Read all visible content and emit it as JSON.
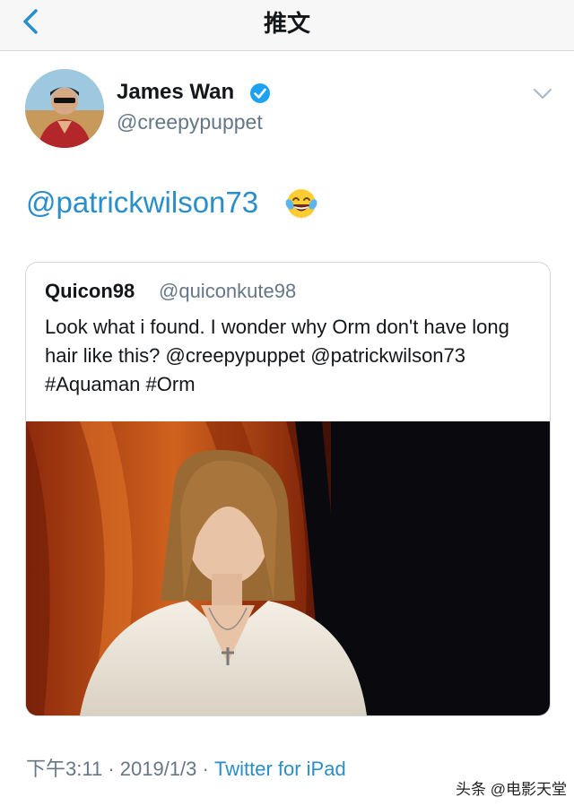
{
  "nav": {
    "title": "推文"
  },
  "tweet": {
    "author_name": "James Wan",
    "author_handle": "@creepypuppet",
    "text_mention": "@patrickwilson73",
    "emoji": "laughing-tears",
    "time": "下午3:11",
    "date": "2019/1/3",
    "separator": "·",
    "source": "Twitter for iPad"
  },
  "quoted": {
    "author_name": "Quicon98",
    "author_handle": "@quiconkute98",
    "text": "Look what i found. I wonder why Orm don't have long hair like this? @creepypuppet @patrickwilson73 #Aquaman #Orm"
  },
  "watermark": "头条 @电影天堂",
  "colors": {
    "link": "#2a8ec8",
    "secondary": "#657786",
    "curtain": "#c0501a"
  }
}
